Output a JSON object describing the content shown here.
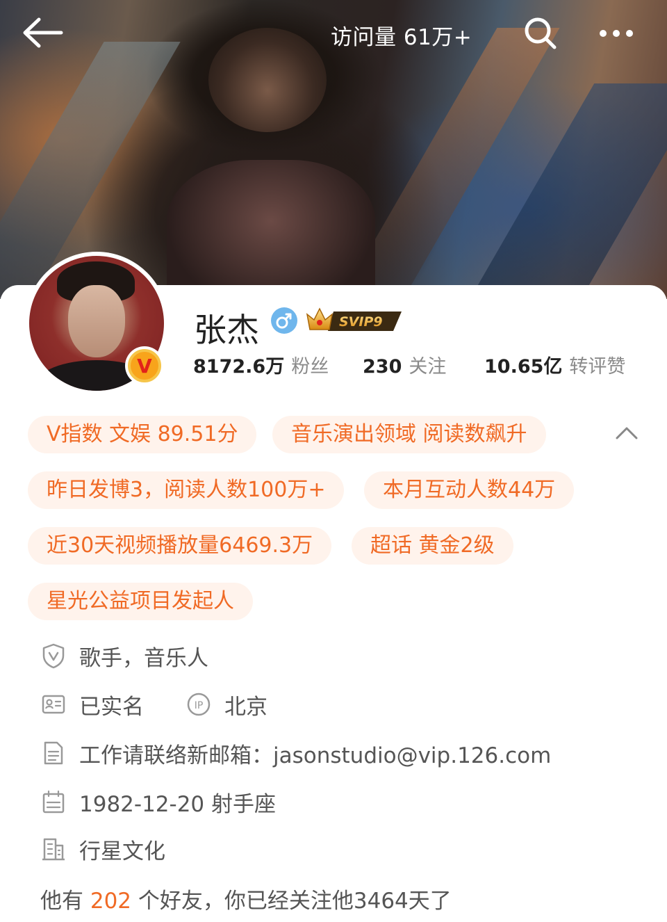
{
  "header": {
    "visits_label": "访问量 61万+",
    "icons": [
      "back-arrow-icon",
      "search-icon",
      "more-icon"
    ]
  },
  "profile": {
    "name": "张杰",
    "gender": "male",
    "vip_badge": "SVIP9",
    "verified_badge": "V",
    "stats": [
      {
        "value": "8172.6万",
        "label": "粉丝"
      },
      {
        "value": "230",
        "label": "关注"
      },
      {
        "value": "10.65亿",
        "label": "转评赞"
      }
    ]
  },
  "tags": [
    "V指数 文娱 89.51分",
    "音乐演出领域 阅读数飙升",
    "昨日发博3，阅读人数100万+",
    "本月互动人数44万",
    "近30天视频播放量6469.3万",
    "超话 黄金2级",
    "星光公益项目发起人"
  ],
  "info": {
    "verification": "歌手，音乐人",
    "real_name": "已实名",
    "ip_location": "北京",
    "contact": "工作请联络新邮箱：jasonstudio@vip.126.com",
    "birthday": "1982-12-20 射手座",
    "company": "行星文化"
  },
  "friends": {
    "prefix": "他有",
    "count": "202",
    "suffix": "个好友，你已经关注他3464天了"
  },
  "colors": {
    "accent": "#f06a25",
    "tag_bg": "#fff3ec",
    "gender_blue": "#6fb6ec",
    "verified_gold": "#f8a41b"
  }
}
